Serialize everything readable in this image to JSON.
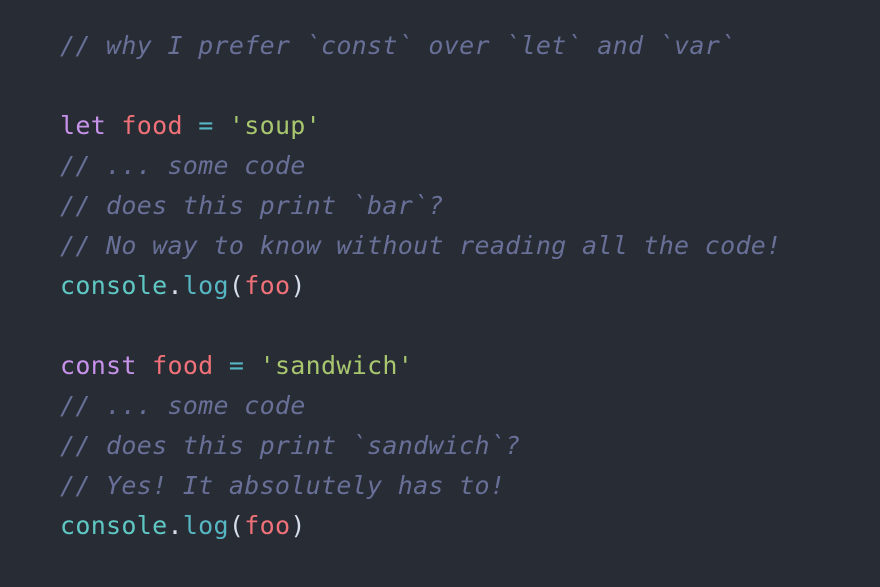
{
  "editor": {
    "language": "javascript",
    "background_color": "#282c35",
    "comment_color": "#697098",
    "keyword_color": "#c792ea",
    "variable_color": "#f07178",
    "string_color": "#a8c76f",
    "operator_color": "#56b6c2",
    "punctuation_color": "#d6deeb"
  },
  "lines": [
    {
      "index": 0,
      "type": "comment",
      "text": "// why I prefer `const` over `let` and `var`",
      "tokens": [
        {
          "kind": "comment",
          "text": "// why I prefer `const` over `let` and `var`"
        }
      ]
    },
    {
      "index": 1,
      "type": "blank",
      "text": "",
      "tokens": []
    },
    {
      "index": 2,
      "type": "code",
      "text": "let food = 'soup'",
      "tokens": [
        {
          "kind": "keyword",
          "text": "let"
        },
        {
          "kind": "plain",
          "text": " "
        },
        {
          "kind": "variable",
          "text": "food"
        },
        {
          "kind": "plain",
          "text": " "
        },
        {
          "kind": "operator",
          "text": "="
        },
        {
          "kind": "plain",
          "text": " "
        },
        {
          "kind": "string",
          "text": "'soup'"
        }
      ]
    },
    {
      "index": 3,
      "type": "comment",
      "text": "// ... some code",
      "tokens": [
        {
          "kind": "comment",
          "text": "// ... some code"
        }
      ]
    },
    {
      "index": 4,
      "type": "comment",
      "text": "// does this print `bar`?",
      "tokens": [
        {
          "kind": "comment",
          "text": "// does this print `bar`?"
        }
      ]
    },
    {
      "index": 5,
      "type": "comment",
      "text": "// No way to know without reading all the code!",
      "tokens": [
        {
          "kind": "comment",
          "text": "// No way to know without reading all the code!"
        }
      ]
    },
    {
      "index": 6,
      "type": "code",
      "text": "console.log(foo)",
      "tokens": [
        {
          "kind": "object",
          "text": "console"
        },
        {
          "kind": "punct",
          "text": "."
        },
        {
          "kind": "property",
          "text": "log"
        },
        {
          "kind": "punct",
          "text": "("
        },
        {
          "kind": "variable",
          "text": "foo"
        },
        {
          "kind": "punct",
          "text": ")"
        }
      ]
    },
    {
      "index": 7,
      "type": "blank",
      "text": "",
      "tokens": []
    },
    {
      "index": 8,
      "type": "code",
      "text": "const food = 'sandwich'",
      "tokens": [
        {
          "kind": "keyword",
          "text": "const"
        },
        {
          "kind": "plain",
          "text": " "
        },
        {
          "kind": "variable",
          "text": "food"
        },
        {
          "kind": "plain",
          "text": " "
        },
        {
          "kind": "operator",
          "text": "="
        },
        {
          "kind": "plain",
          "text": " "
        },
        {
          "kind": "string",
          "text": "'sandwich'"
        }
      ]
    },
    {
      "index": 9,
      "type": "comment",
      "text": "// ... some code",
      "tokens": [
        {
          "kind": "comment",
          "text": "// ... some code"
        }
      ]
    },
    {
      "index": 10,
      "type": "comment",
      "text": "// does this print `sandwich`?",
      "tokens": [
        {
          "kind": "comment",
          "text": "// does this print `sandwich`?"
        }
      ]
    },
    {
      "index": 11,
      "type": "comment",
      "text": "// Yes! It absolutely has to!",
      "tokens": [
        {
          "kind": "comment",
          "text": "// Yes! It absolutely has to!"
        }
      ]
    },
    {
      "index": 12,
      "type": "code",
      "text": "console.log(foo)",
      "tokens": [
        {
          "kind": "object",
          "text": "console"
        },
        {
          "kind": "punct",
          "text": "."
        },
        {
          "kind": "property",
          "text": "log"
        },
        {
          "kind": "punct",
          "text": "("
        },
        {
          "kind": "variable",
          "text": "foo"
        },
        {
          "kind": "punct",
          "text": ")"
        }
      ]
    }
  ]
}
